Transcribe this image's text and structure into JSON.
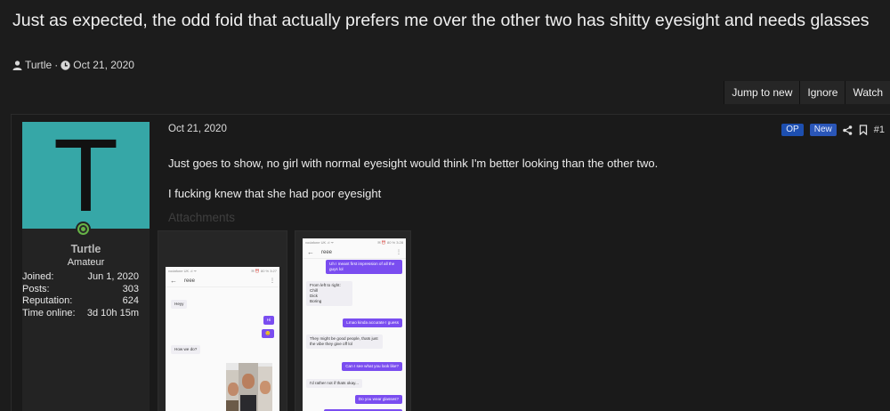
{
  "thread": {
    "title": "Just as expected, the odd foid that actually prefers me over the other two has shitty eyesight and needs glasses",
    "author": "Turtle",
    "separator": "·",
    "date": "Oct 21, 2020"
  },
  "actions": [
    "Jump to new",
    "Ignore",
    "Watch"
  ],
  "user": {
    "avatar_letter": "T",
    "name": "Turtle",
    "title": "Amateur",
    "stats": [
      {
        "label": "Joined:",
        "value": "Jun 1, 2020"
      },
      {
        "label": "Posts:",
        "value": "303"
      },
      {
        "label": "Reputation:",
        "value": "624"
      },
      {
        "label": "Time online:",
        "value": "3d 10h 15m"
      }
    ]
  },
  "post": {
    "date": "Oct 21, 2020",
    "badge_op": "OP",
    "badge_new": "New",
    "number": "#1",
    "paragraphs": [
      "Just goes to show, no girl with normal eyesight would think I'm better looking than the other two.",
      "I fucking knew that she had poor eyesight"
    ],
    "attachments_label": "Attachments"
  },
  "screenshot1": {
    "status_left": "vodafone UK .ıl ᯤ",
    "status_right": "✉ ⏰ 80 % 3:27",
    "contact": "reee",
    "messages": [
      "Heyy",
      "Hi",
      "😊",
      "How we do?"
    ]
  },
  "screenshot2": {
    "status_left": "vodafone UK .ıl ᯤ",
    "status_right": "✉ ⏰ 80 % 3:28",
    "contact": "reee",
    "messages": [
      "Uh I meant first impression of all the guys lol",
      "From left to right:",
      "Chill",
      "Dick",
      "Boring",
      "Lmao kinda accurate I guess",
      "They might be good people, thats just the vibe they give off lol",
      "Can I see what you look like?",
      "I'd rather not if thats okay...",
      "Do you wear glasses?"
    ]
  },
  "icons": {
    "author": "user-icon",
    "date": "clock-icon",
    "share": "share-icon",
    "bookmark": "bookmark-icon",
    "online": "online-status-icon"
  },
  "colors": {
    "background": "#1c1c1c",
    "avatar": "#36a7a7",
    "badge": "#1d4fb0",
    "bubble_out": "#7a4df0",
    "online": "#66b346"
  }
}
